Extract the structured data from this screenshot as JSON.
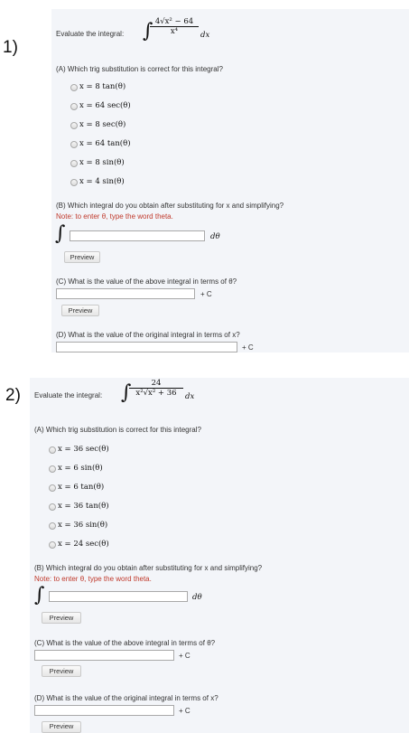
{
  "problems": [
    {
      "number": "1)",
      "prompt_label": "Evaluate the integral:",
      "integrand_numerator": "4√x² − 64",
      "integrand_denominator": "x⁴",
      "integrand_dx": "dx",
      "part_a_question": "(A) Which trig substitution is correct for this integral?",
      "options": [
        "x = 8 tan(θ)",
        "x = 64 sec(θ)",
        "x = 8 sec(θ)",
        "x = 64 tan(θ)",
        "x = 8 sin(θ)",
        "x = 4 sin(θ)"
      ],
      "part_b_question": "(B) Which integral do you obtain after substituting for x and simplifying?",
      "part_b_note": "Note: to enter θ, type the word theta.",
      "part_b_integral_sign": "∫",
      "part_b_dtheta": "dθ",
      "part_b_value": "",
      "preview_label": "Preview",
      "part_c_question": "(C) What is the value of the above integral in terms of θ?",
      "part_c_value": "",
      "plus_c": "+ C",
      "part_d_question": "(D) What is the value of the original integral in terms of x?",
      "part_d_value": ""
    },
    {
      "number": "2)",
      "prompt_label": "Evaluate the integral:",
      "integrand_numerator": "24",
      "integrand_denominator": "x²√x² + 36",
      "integrand_dx": "dx",
      "part_a_question": "(A) Which trig substitution is correct for this integral?",
      "options": [
        "x = 36 sec(θ)",
        "x = 6 sin(θ)",
        "x = 6 tan(θ)",
        "x = 36 tan(θ)",
        "x = 36 sin(θ)",
        "x = 24 sec(θ)"
      ],
      "part_b_question": "(B) Which integral do you obtain after substituting for x and simplifying?",
      "part_b_note": "Note: to enter θ, type the word theta.",
      "part_b_integral_sign": "∫",
      "part_b_dtheta": "dθ",
      "part_b_value": "",
      "preview_label": "Preview",
      "part_c_question": "(C) What is the value of the above integral in terms of θ?",
      "part_c_value": "",
      "plus_c": "+ C",
      "part_d_question": "(D) What is the value of the original integral in terms of x?",
      "part_d_value": "",
      "preview_label_cut": "Preview"
    }
  ],
  "colors": {
    "panel": "#f3f5f9",
    "note_red": "#c0392b"
  }
}
